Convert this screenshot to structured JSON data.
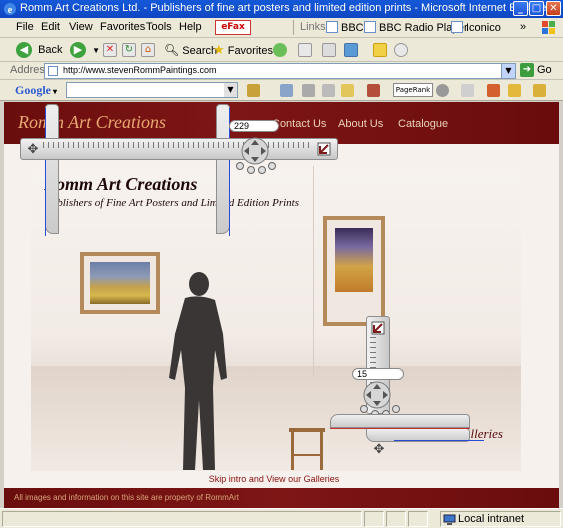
{
  "window": {
    "title": "Romm Art Creations Ltd. - Publishers of fine art posters and limited edition prints - Microsoft Internet Explorer",
    "buttons": [
      "_",
      "□",
      "✕"
    ]
  },
  "menubar": {
    "items": [
      "File",
      "Edit",
      "View",
      "Favorites",
      "Tools",
      "Help"
    ],
    "efax": "eFax",
    "links_label": "Links",
    "links": [
      "BBC",
      "BBC Radio Player",
      "Iconico"
    ],
    "chevron": "»"
  },
  "toolbar": {
    "back": "Back",
    "search": "Search",
    "favorites": "Favorites"
  },
  "address": {
    "label": "Address",
    "url": "http://www.stevenRommPaintings.com",
    "go": "Go"
  },
  "googlebar": {
    "logo": "Google",
    "search_value": "",
    "pagerank": "PageRank"
  },
  "site": {
    "brand": "Romm Art Creations",
    "nav": [
      "Contact Us",
      "About Us",
      "Catalogue"
    ],
    "title": "Romm Art Creations",
    "subtitle": "Publishers of Fine Art Posters and Limited Edition Prints",
    "gallery_link": "View our Galleries",
    "skip_link": "Skip intro and View our Galleries",
    "footer": "All images and information on this site are property of RommArt"
  },
  "rulers": {
    "horizontal_value": "229",
    "vertical_value": "15"
  },
  "statusbar": {
    "zone": "Local intranet"
  },
  "colors": {
    "header_maroon": "#6a0d0d",
    "nav_text": "#ecd3b7",
    "frame_wood": "#b48a5a"
  }
}
